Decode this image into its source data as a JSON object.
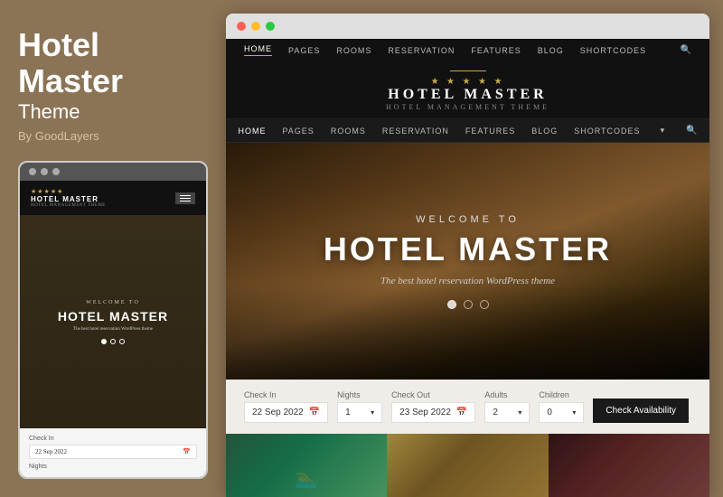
{
  "left": {
    "title_line1": "Hotel",
    "title_line2": "Master",
    "theme_label": "Theme",
    "by_line": "By GoodLayers"
  },
  "mobile": {
    "stars": "★★★★★",
    "logo_text": "HOTEL MASTER",
    "logo_sub": "HOTEL MANAGEMENT THEME",
    "hero_welcome": "WELCOME TO",
    "hero_title": "HOTEL MASTER",
    "hero_sub": "The best hotel reservation WordPress theme",
    "checkin_label": "Check In",
    "checkin_value": "22 Sep 2022",
    "nights_label": "Nights"
  },
  "browser": {
    "top_nav": [
      "HOME",
      "PAGES",
      "ROOMS",
      "RESERVATION",
      "FEATURES",
      "BLOG",
      "SHORTCODES"
    ],
    "logo_stars": "★ ★ ★ ★ ★",
    "logo_main": "HOTEL MASTER",
    "logo_sub": "Hotel Management Theme",
    "second_nav": [
      "HOME",
      "PAGES",
      "ROOMS",
      "RESERVATION",
      "FEATURES",
      "BLOG",
      "SHORTCODES"
    ],
    "hero_welcome": "WELCOME TO",
    "hero_title": "HOTEL MASTER",
    "hero_subtitle": "The best hotel reservation WordPress theme",
    "booking": {
      "checkin_label": "Check In",
      "checkin_value": "22 Sep 2022",
      "nights_label": "Nights",
      "nights_value": "1",
      "checkout_label": "Check Out",
      "checkout_value": "23 Sep 2022",
      "adults_label": "Adults",
      "adults_value": "2",
      "children_label": "Children",
      "children_value": "0",
      "btn_label": "Check Availability"
    }
  },
  "colors": {
    "bg": "#8B7355",
    "dark": "#111111",
    "gold": "#c9a84c",
    "btn_dark": "#1a1a1a"
  }
}
